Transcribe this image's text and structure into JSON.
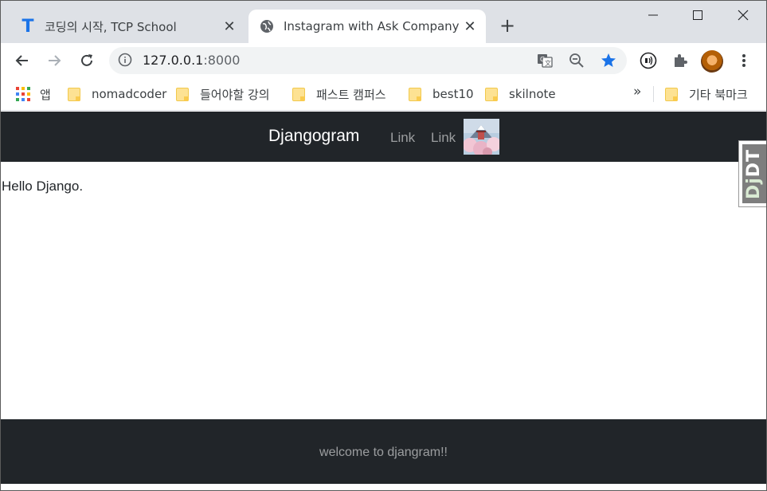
{
  "tabs": [
    {
      "title": "코딩의 시작, TCP School",
      "favicon": "T",
      "favicon_icon": "tcpschool-t-icon"
    },
    {
      "title": "Instagram with Ask Company",
      "favicon_icon": "globe-icon"
    }
  ],
  "toolbar": {
    "url_host": "127.0.0.1",
    "url_port": ":8000"
  },
  "bookmarks": {
    "apps_label": "앱",
    "items": [
      "nomadcoder",
      "들어야할 강의",
      "패스트 캠퍼스",
      "best10",
      "skilnote"
    ],
    "more": "»",
    "other": "기타 북마크"
  },
  "page": {
    "brand": "Djangogram",
    "nav_links": [
      "Link",
      "Link"
    ],
    "main_text": "Hello Django.",
    "footer_text": "welcome to djangram!!"
  },
  "djdt": {
    "label_dj": "Dj",
    "label_dt": "DT"
  },
  "colors": {
    "navbar_bg": "#212529",
    "tab_strip_bg": "#dee1e6",
    "star_blue": "#1a73e8"
  }
}
